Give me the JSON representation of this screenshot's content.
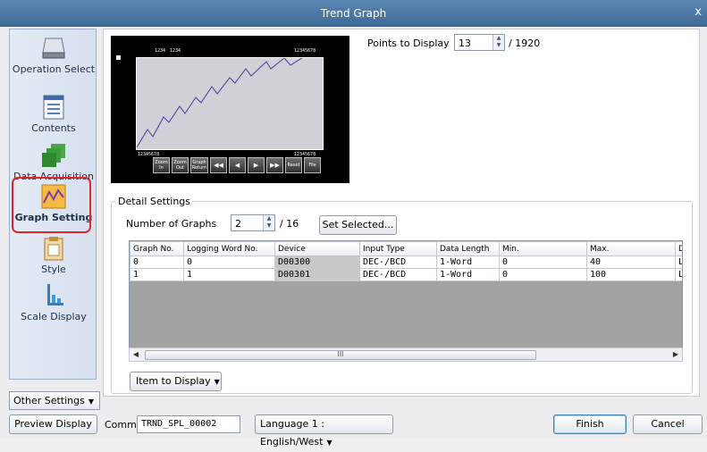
{
  "window": {
    "title": "Trend Graph",
    "close_glyph": "x"
  },
  "sidebar": {
    "items": [
      {
        "label": "Operation Select",
        "icon": "printer-icon"
      },
      {
        "label": "Contents",
        "icon": "document-list-icon"
      },
      {
        "label": "Data Acquisition",
        "icon": "stacked-green-squares-icon"
      },
      {
        "label": "Graph Setting",
        "icon": "line-graph-icon",
        "selected": true
      },
      {
        "label": "Style",
        "icon": "clipboard-icon"
      },
      {
        "label": "Scale Display",
        "icon": "scale-bars-icon"
      }
    ],
    "other_settings": "Other Settings"
  },
  "preview": {
    "header_left_a": "1234",
    "header_left_b": "1234",
    "header_right": "12345678",
    "footer_left": "12345678",
    "footer_right": "12345678",
    "buttons": [
      "Zoom In",
      "Zoom Out",
      "Graph Return",
      "◀◀",
      "◀",
      "▶",
      "▶▶",
      "Reset",
      "File"
    ]
  },
  "points": {
    "label": "Points to Display",
    "value": "13",
    "max": "/ 1920"
  },
  "detail": {
    "title": "Detail Settings",
    "num_graphs_label": "Number of Graphs",
    "num_graphs_value": "2",
    "num_graphs_max": "/ 16",
    "set_selected": "Set Selected..."
  },
  "table": {
    "columns": [
      "Graph No.",
      "Logging Word No.",
      "Device",
      "Input Type",
      "Data Length",
      "Min.",
      "Max.",
      "D"
    ],
    "rows": [
      [
        "0",
        "0",
        "D00300",
        "DEC-/BCD",
        "1-Word",
        "0",
        "40",
        "Li"
      ],
      [
        "1",
        "1",
        "D00301",
        "DEC-/BCD",
        "1-Word",
        "0",
        "100",
        "Li"
      ]
    ],
    "scroll_mark": "III"
  },
  "item_to_display": "Item to Display",
  "bottom": {
    "preview_display": "Preview Display",
    "comm_label": "Comm",
    "comm_value": "TRND_SPL_00002",
    "language": "Language 1 : English/West",
    "finish": "Finish",
    "cancel": "Cancel"
  },
  "colors": {
    "title_bar": "#4f7cab",
    "highlight": "#e0242c",
    "graph_line": "#3a3f9a"
  }
}
